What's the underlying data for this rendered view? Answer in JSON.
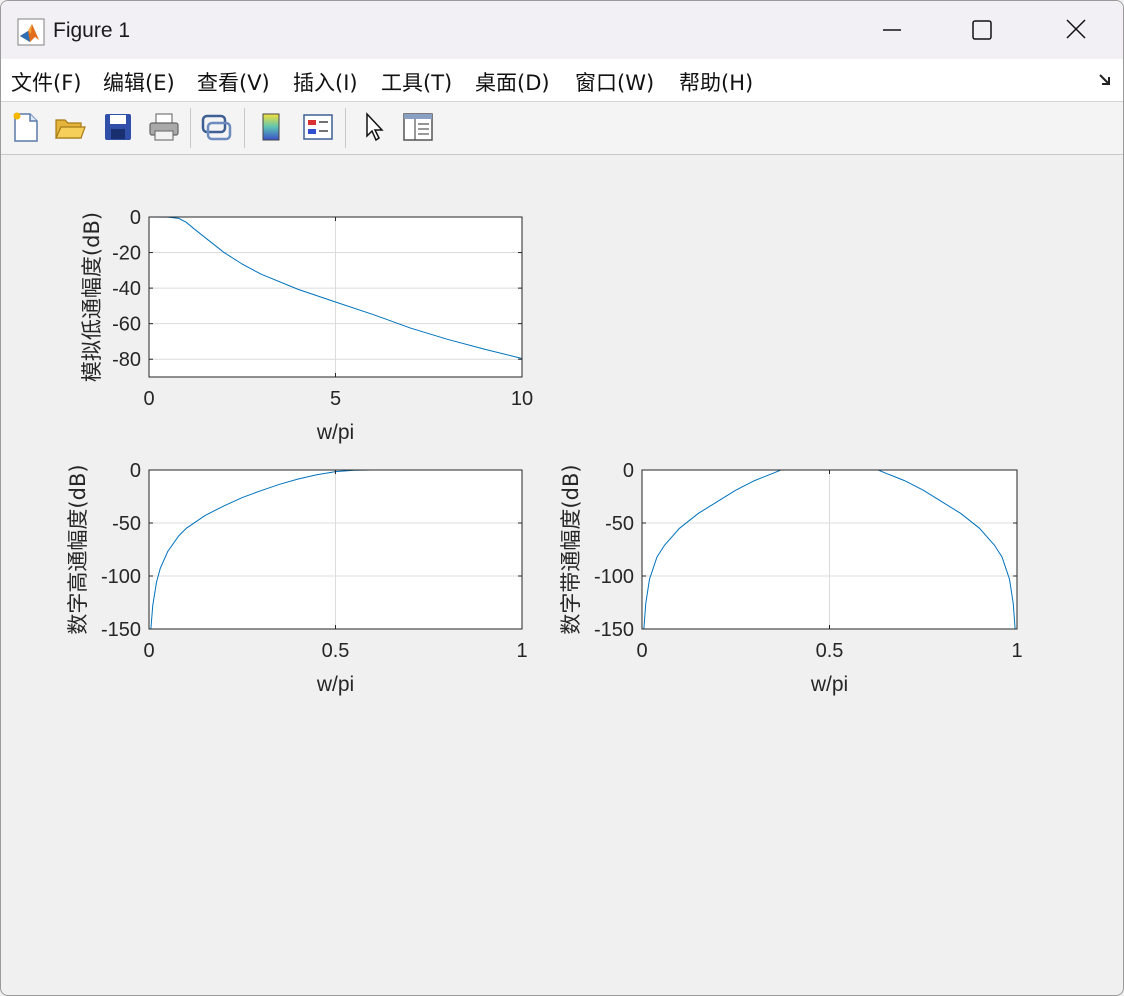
{
  "window": {
    "title": "Figure 1",
    "colors": {
      "titlebar": "#f3f0f5",
      "menubar": "#ffffff",
      "canvas": "#f0f0f0",
      "line": "#0072bd"
    }
  },
  "menubar": {
    "items": [
      {
        "label": "文件(F)"
      },
      {
        "label": "编辑(E)"
      },
      {
        "label": "查看(V)"
      },
      {
        "label": "插入(I)"
      },
      {
        "label": "工具(T)"
      },
      {
        "label": "桌面(D)"
      },
      {
        "label": "窗口(W)"
      },
      {
        "label": "帮助(H)"
      }
    ]
  },
  "toolbar": {
    "icons": [
      "new-figure-icon",
      "open-folder-icon",
      "save-icon",
      "print-icon",
      "link-plot-icon",
      "colorbar-icon",
      "legend-icon",
      "pointer-icon",
      "property-editor-icon"
    ]
  },
  "chart_data": [
    {
      "type": "line",
      "xlabel": "w/pi",
      "ylabel": "模拟低通幅度(dB)",
      "xlim": [
        0,
        10
      ],
      "ylim": [
        -90,
        0
      ],
      "xticks": [
        0,
        5,
        10
      ],
      "yticks": [
        0,
        -20,
        -40,
        -60,
        -80
      ],
      "grid": true,
      "x": [
        0,
        0.5,
        0.8,
        1,
        1.2,
        1.5,
        2,
        2.5,
        3,
        4,
        5,
        6,
        7,
        8,
        9,
        10
      ],
      "y": [
        0,
        -0.1,
        -0.8,
        -3,
        -6.5,
        -11.5,
        -19.8,
        -26.5,
        -32.1,
        -40.7,
        -47.8,
        -54.8,
        -62.4,
        -68.8,
        -74.4,
        -79.6
      ]
    },
    {
      "type": "line",
      "xlabel": "w/pi",
      "ylabel": "数字高通幅度(dB)",
      "xlim": [
        0,
        1
      ],
      "ylim": [
        -150,
        0
      ],
      "xticks": [
        0,
        0.5,
        1
      ],
      "yticks": [
        0,
        -50,
        -100,
        -150
      ],
      "grid": true,
      "x": [
        0.005,
        0.01,
        0.02,
        0.03,
        0.05,
        0.08,
        0.1,
        0.15,
        0.2,
        0.25,
        0.3,
        0.35,
        0.4,
        0.45,
        0.5,
        0.55,
        0.6,
        0.7,
        0.8,
        0.9,
        1.0
      ],
      "y": [
        -150,
        -128,
        -106,
        -93,
        -77,
        -62,
        -55,
        -43,
        -34,
        -26,
        -19.5,
        -13.5,
        -8.5,
        -4.5,
        -1.5,
        -0.2,
        0,
        0,
        0,
        0,
        0
      ]
    },
    {
      "type": "line",
      "xlabel": "w/pi",
      "ylabel": "数字带通幅度(dB)",
      "xlim": [
        0,
        1
      ],
      "ylim": [
        -150,
        0
      ],
      "xticks": [
        0,
        0.5,
        1
      ],
      "yticks": [
        0,
        -50,
        -100,
        -150
      ],
      "grid": true,
      "x": [
        0.005,
        0.01,
        0.02,
        0.04,
        0.06,
        0.1,
        0.15,
        0.2,
        0.25,
        0.3,
        0.35,
        0.37,
        0.4,
        0.5,
        0.6,
        0.63,
        0.65,
        0.7,
        0.75,
        0.8,
        0.85,
        0.9,
        0.94,
        0.96,
        0.98,
        0.99,
        0.995
      ],
      "y": [
        -150,
        -126,
        -103,
        -82,
        -71,
        -55,
        -41,
        -30,
        -19,
        -10,
        -3,
        0,
        0,
        0,
        0,
        0,
        -3,
        -10,
        -19,
        -30,
        -41,
        -55,
        -71,
        -82,
        -103,
        -126,
        -150
      ]
    }
  ]
}
